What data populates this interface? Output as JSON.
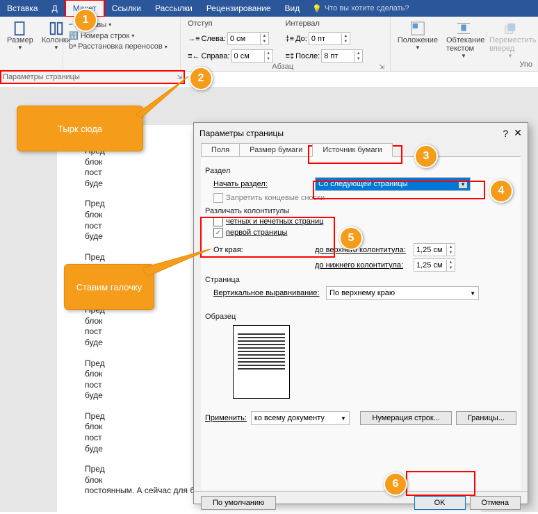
{
  "ribbon": {
    "tabs": [
      "Вставка",
      "Д",
      "Макет",
      "Ссылки",
      "Рассылки",
      "Рецензирование",
      "Вид"
    ],
    "active_tab": "Макет",
    "tell_me": "Что вы хотите сделать?",
    "size_label": "Размер",
    "columns_label": "Колонки",
    "breaks_label": "Разрывы",
    "line_numbers_label": "Номера строк",
    "hyphenation_label": "Расстановка переносов",
    "indent_title": "Отступ",
    "indent_left_label": "Слева:",
    "indent_right_label": "Справа:",
    "indent_left_value": "0 см",
    "indent_right_value": "0 см",
    "interval_title": "Интервал",
    "interval_before_label": "До:",
    "interval_after_label": "После:",
    "interval_before_value": "0 пт",
    "interval_after_value": "8 пт",
    "paragraph_group": "Абзац",
    "position_label": "Положение",
    "wrap_label": "Обтекание текстом",
    "move_label": "Переместить вперед",
    "arrange_group": "Упо",
    "page_params_label": "Параметры страницы"
  },
  "callouts": {
    "click_here": "Тырк сюда",
    "set_check": "Ставим галочку"
  },
  "badges": {
    "b1": "1",
    "b2": "2",
    "b3": "3",
    "b4": "4",
    "b5": "5",
    "b6": "6"
  },
  "dialog": {
    "title": "Параметры страницы",
    "tab1": "Поля",
    "tab2": "Размер бумаги",
    "tab3": "Источник бумаги",
    "section_label": "Раздел",
    "start_section_label": "Начать раздел:",
    "start_section_value": "Со следующей страницы",
    "suppress_endnotes": "Запретить концевые сноски",
    "headers_label": "Различать колонтитулы",
    "odd_even": "четных и нечетных страниц",
    "first_page": "первой страницы",
    "from_edge_label": "От края:",
    "header_dist_label": "до верхнего колонтитула:",
    "footer_dist_label": "до нижнего колонтитула:",
    "header_dist_value": "1,25 см",
    "footer_dist_value": "1,25 см",
    "page_label": "Страница",
    "valign_label": "Вертикальное выравнивание:",
    "valign_value": "По верхнему краю",
    "preview_label": "Образец",
    "apply_label": "Применить:",
    "apply_value": "ко всему документу",
    "line_numbers_btn": "Нумерация строк...",
    "borders_btn": "Границы...",
    "default_btn": "По умолчанию",
    "ok_btn": "OK",
    "cancel_btn": "Отмена"
  },
  "doc": {
    "p1": "Пред",
    "p2": "блок",
    "p3": "пост",
    "p4": "буде",
    "p5": "постоянным. А сейчас для более полного заполнения блока текстовой инфор мацией"
  }
}
